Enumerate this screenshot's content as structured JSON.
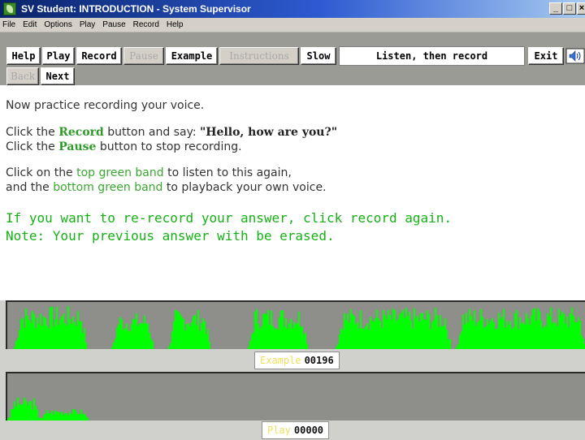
{
  "window": {
    "title": "SV Student: INTRODUCTION - System Supervisor",
    "min_label": "_",
    "max_label": "□",
    "close_label": "×"
  },
  "menu": [
    "File",
    "Edit",
    "Options",
    "Play",
    "Pause",
    "Record",
    "Help"
  ],
  "toolbar": {
    "help": "Help",
    "play": "Play",
    "record": "Record",
    "pause": "Pause",
    "example": "Example",
    "instructions": "Instructions",
    "slow": "Slow",
    "status": "Listen, then record",
    "exit": "Exit",
    "back": "Back",
    "next": "Next"
  },
  "content": {
    "intro": "Now practice recording your voice.",
    "line2_pre": "Click the ",
    "line2_btn": "Record",
    "line2_mid": " button and say: ",
    "line2_quote": "\"Hello, how are you?\"",
    "line3_pre": "Click the ",
    "line3_btn": "Pause",
    "line3_post": " button to stop recording.",
    "line4_pre": "Click on the ",
    "line4_link": "top green band",
    "line4_post": " to listen to this again,",
    "line5_pre": "and the ",
    "line5_link": "bottom green band",
    "line5_post": " to playback your own voice.",
    "rerecord": "If you want to re-record your answer, click record again.",
    "note": "Note: Your previous answer with be erased."
  },
  "example_counter": {
    "label": "Example",
    "value": "00196"
  },
  "play_counter": {
    "label": "Play",
    "value": "00000"
  },
  "colors": {
    "wave": "#00ff00",
    "band_bg": "#8e8e8a",
    "title_bar": "#0a246a"
  }
}
